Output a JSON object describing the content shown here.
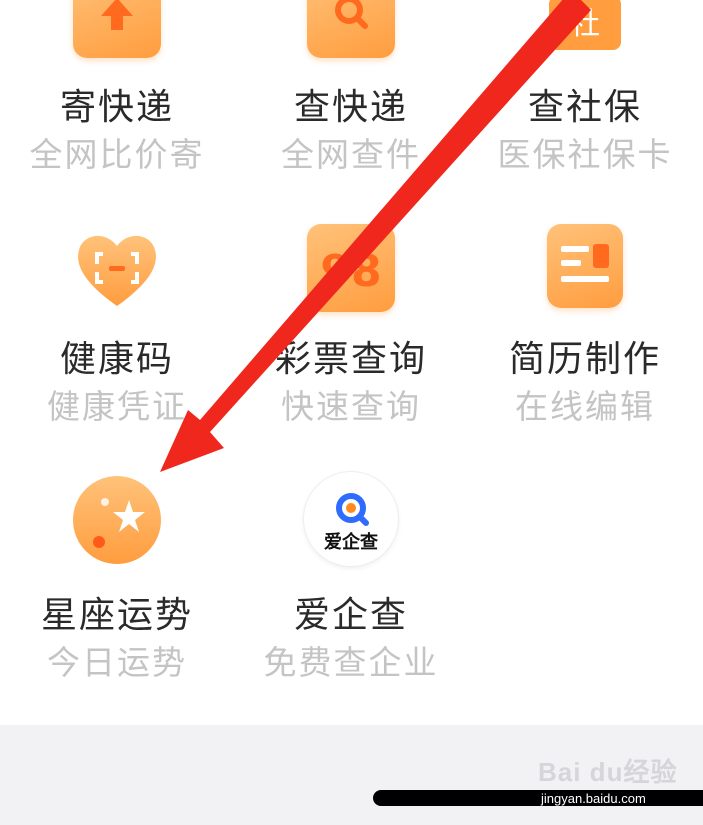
{
  "services": [
    {
      "title": "寄快递",
      "subtitle": "全网比价寄",
      "icon": "package-send-icon"
    },
    {
      "title": "查快递",
      "subtitle": "全网查件",
      "icon": "package-search-icon"
    },
    {
      "title": "查社保",
      "subtitle": "医保社保卡",
      "icon": "social-security-icon",
      "icon_text": "社"
    },
    {
      "title": "健康码",
      "subtitle": "健康凭证",
      "icon": "health-code-heart-icon"
    },
    {
      "title": "彩票查询",
      "subtitle": "快速查询",
      "icon": "lottery-icon",
      "icon_text": "98"
    },
    {
      "title": "简历制作",
      "subtitle": "在线编辑",
      "icon": "resume-icon"
    },
    {
      "title": "星座运势",
      "subtitle": "今日运势",
      "icon": "horoscope-star-icon"
    },
    {
      "title": "爱企查",
      "subtitle": "免费查企业",
      "icon": "aiqicha-logo-icon",
      "icon_text": "爱企查"
    }
  ],
  "watermark": {
    "logo": "Bai du经验",
    "url": "jingyan.baidu.com"
  },
  "colors": {
    "accent": "#ff9d3f",
    "arrow": "#f0271c",
    "aiqicha_blue": "#2f6bff"
  }
}
